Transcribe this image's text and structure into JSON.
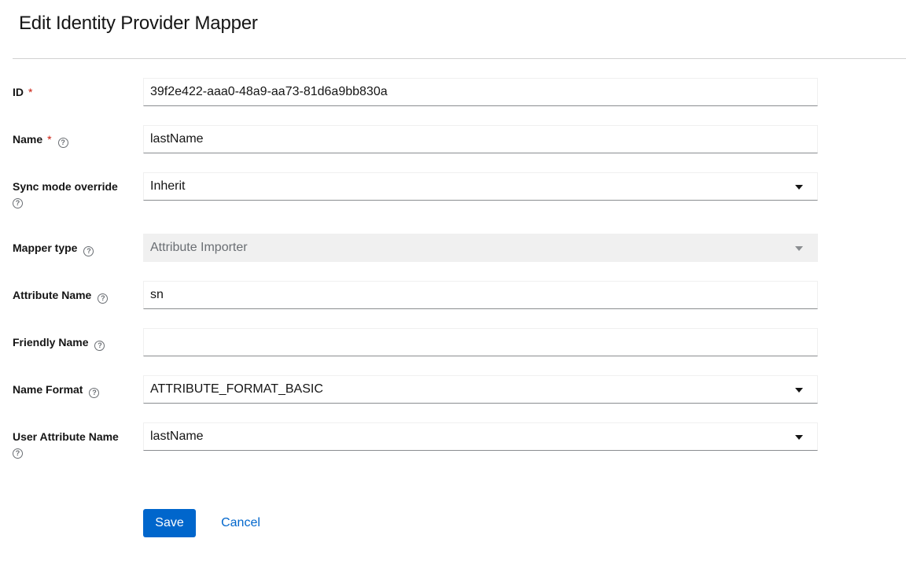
{
  "page": {
    "title": "Edit Identity Provider Mapper"
  },
  "fields": {
    "id": {
      "label": "ID",
      "required": "*",
      "value": "39f2e422-aaa0-48a9-aa73-81d6a9bb830a"
    },
    "name": {
      "label": "Name",
      "required": "*",
      "value": "lastName"
    },
    "sync_mode": {
      "label": "Sync mode override",
      "value": "Inherit"
    },
    "mapper_type": {
      "label": "Mapper type",
      "value": "Attribute Importer"
    },
    "attribute_name": {
      "label": "Attribute Name",
      "value": "sn"
    },
    "friendly_name": {
      "label": "Friendly Name",
      "value": ""
    },
    "name_format": {
      "label": "Name Format",
      "value": "ATTRIBUTE_FORMAT_BASIC"
    },
    "user_attribute_name": {
      "label": "User Attribute Name",
      "value": "lastName"
    }
  },
  "actions": {
    "save_label": "Save",
    "cancel_label": "Cancel"
  },
  "icons": {
    "help": "help-circle-icon",
    "caret": "caret-down-icon"
  },
  "colors": {
    "primary": "#0066cc",
    "required": "#c9190b",
    "disabled_bg": "#f0f0f0"
  }
}
